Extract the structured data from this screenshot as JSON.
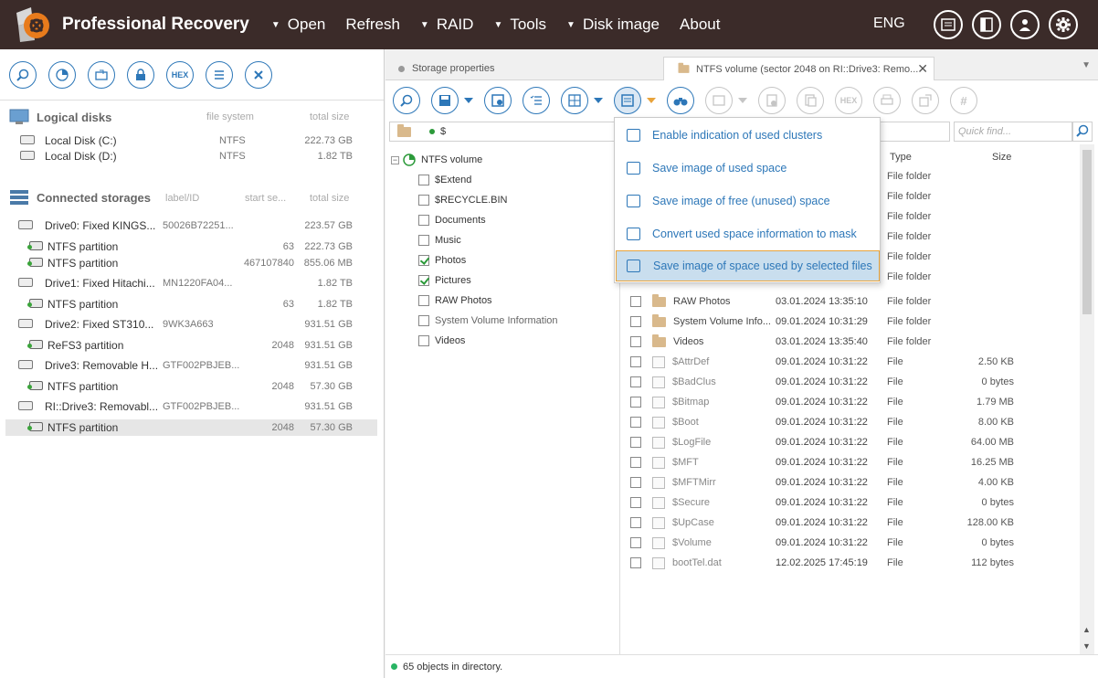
{
  "app": {
    "title": "Professional Recovery",
    "menu": [
      {
        "label": "Open",
        "dropdown": true
      },
      {
        "label": "Refresh",
        "dropdown": false
      },
      {
        "label": "RAID",
        "dropdown": true
      },
      {
        "label": "Tools",
        "dropdown": true
      },
      {
        "label": "Disk image",
        "dropdown": true
      },
      {
        "label": "About",
        "dropdown": false
      }
    ],
    "language": "ENG"
  },
  "left": {
    "logical": {
      "title": "Logical disks",
      "col_fs": "file system",
      "col_size": "total size",
      "items": [
        {
          "name": "Local Disk (C:)",
          "fs": "NTFS",
          "size": "222.73 GB"
        },
        {
          "name": "Local Disk (D:)",
          "fs": "NTFS",
          "size": "1.82 TB"
        }
      ]
    },
    "connected": {
      "title": "Connected storages",
      "col_label": "label/ID",
      "col_start": "start se...",
      "col_size": "total size",
      "items": [
        {
          "kind": "drive",
          "name": "Drive0: Fixed KINGS...",
          "label": "50026B72251...",
          "start": "",
          "size": "223.57 GB"
        },
        {
          "kind": "part",
          "name": "NTFS partition",
          "label": "",
          "start": "63",
          "size": "222.73 GB"
        },
        {
          "kind": "part",
          "name": "NTFS partition",
          "label": "",
          "start": "467107840",
          "size": "855.06 MB"
        },
        {
          "kind": "drive",
          "name": "Drive1: Fixed Hitachi...",
          "label": "MN1220FA04...",
          "start": "",
          "size": "1.82 TB"
        },
        {
          "kind": "part",
          "name": "NTFS partition",
          "label": "",
          "start": "63",
          "size": "1.82 TB"
        },
        {
          "kind": "drive",
          "name": "Drive2: Fixed ST310...",
          "label": "9WK3A663",
          "start": "",
          "size": "931.51 GB"
        },
        {
          "kind": "part",
          "name": "ReFS3 partition",
          "label": "",
          "start": "2048",
          "size": "931.51 GB"
        },
        {
          "kind": "drive",
          "name": "Drive3: Removable H...",
          "label": "GTF002PBJEB...",
          "start": "",
          "size": "931.51 GB"
        },
        {
          "kind": "part",
          "name": "NTFS partition",
          "label": "",
          "start": "2048",
          "size": "57.30 GB"
        },
        {
          "kind": "drive",
          "name": "RI::Drive3: Removabl...",
          "label": "GTF002PBJEB...",
          "start": "",
          "size": "931.51 GB"
        },
        {
          "kind": "part",
          "name": "NTFS partition",
          "label": "",
          "start": "2048",
          "size": "57.30 GB",
          "selected": true
        }
      ]
    }
  },
  "right": {
    "tabs": [
      {
        "label": "Storage properties"
      },
      {
        "label": "NTFS volume (sector 2048 on RI::Drive3: Remo..."
      }
    ],
    "path": "$",
    "find_placeholder": "Quick find...",
    "tree_root": "NTFS volume",
    "tree": [
      {
        "name": "$Extend",
        "checked": false
      },
      {
        "name": "$RECYCLE.BIN",
        "checked": false
      },
      {
        "name": "Documents",
        "checked": false
      },
      {
        "name": "Music",
        "checked": false
      },
      {
        "name": "Photos",
        "checked": true
      },
      {
        "name": "Pictures",
        "checked": true
      },
      {
        "name": "RAW Photos",
        "checked": false
      },
      {
        "name": "System Volume Information",
        "checked": false
      },
      {
        "name": "Videos",
        "checked": false
      }
    ],
    "columns": {
      "type": "Type",
      "size": "Size"
    },
    "hidden_types": [
      "File folder",
      "File folder",
      "File folder",
      "File folder",
      "File folder",
      "File folder"
    ],
    "files": [
      {
        "name": "RAW Photos",
        "date": "03.01.2024 13:35:10",
        "type": "File folder",
        "size": "",
        "folder": true
      },
      {
        "name": "System Volume Info...",
        "date": "09.01.2024 10:31:29",
        "type": "File folder",
        "size": "",
        "folder": true
      },
      {
        "name": "Videos",
        "date": "03.01.2024 13:35:40",
        "type": "File folder",
        "size": "",
        "folder": true
      },
      {
        "name": "$AttrDef",
        "date": "09.01.2024 10:31:22",
        "type": "File",
        "size": "2.50 KB",
        "folder": false
      },
      {
        "name": "$BadClus",
        "date": "09.01.2024 10:31:22",
        "type": "File",
        "size": "0 bytes",
        "folder": false
      },
      {
        "name": "$Bitmap",
        "date": "09.01.2024 10:31:22",
        "type": "File",
        "size": "1.79 MB",
        "folder": false
      },
      {
        "name": "$Boot",
        "date": "09.01.2024 10:31:22",
        "type": "File",
        "size": "8.00 KB",
        "folder": false
      },
      {
        "name": "$LogFile",
        "date": "09.01.2024 10:31:22",
        "type": "File",
        "size": "64.00 MB",
        "folder": false
      },
      {
        "name": "$MFT",
        "date": "09.01.2024 10:31:22",
        "type": "File",
        "size": "16.25 MB",
        "folder": false
      },
      {
        "name": "$MFTMirr",
        "date": "09.01.2024 10:31:22",
        "type": "File",
        "size": "4.00 KB",
        "folder": false
      },
      {
        "name": "$Secure",
        "date": "09.01.2024 10:31:22",
        "type": "File",
        "size": "0 bytes",
        "folder": false
      },
      {
        "name": "$UpCase",
        "date": "09.01.2024 10:31:22",
        "type": "File",
        "size": "128.00 KB",
        "folder": false
      },
      {
        "name": "$Volume",
        "date": "09.01.2024 10:31:22",
        "type": "File",
        "size": "0 bytes",
        "folder": false
      },
      {
        "name": "bootTel.dat",
        "date": "12.02.2025 17:45:19",
        "type": "File",
        "size": "112 bytes",
        "folder": false
      }
    ],
    "status": "65 objects in directory."
  },
  "dropdown": {
    "items": [
      {
        "label": "Enable indication of used clusters",
        "highlighted": false
      },
      {
        "label": "Save image of used space",
        "highlighted": false
      },
      {
        "label": "Save image of free (unused) space",
        "highlighted": false
      },
      {
        "label": "Convert used space information to mask",
        "highlighted": false
      },
      {
        "label": "Save image of space used by selected files",
        "highlighted": true
      }
    ]
  },
  "icons": {
    "left_toolbar": [
      "search-icon",
      "scan-icon",
      "open-image-icon",
      "lock-icon",
      "hex-icon",
      "list-icon",
      "close-icon"
    ],
    "right_toolbar": [
      "search-icon",
      "save-icon",
      "settings-disk-icon",
      "checklist-icon",
      "grid-icon",
      "cluster-map-icon",
      "binoculars-icon",
      "preview-icon",
      "disk-settings-icon",
      "copy-icon",
      "hex-icon",
      "print-icon",
      "export-icon",
      "hash-icon"
    ],
    "header": [
      "terminal-icon",
      "panel-icon",
      "user-icon",
      "gear-icon"
    ],
    "hex_label": "HEX",
    "hash_label": "#"
  },
  "colors": {
    "titlebar": "#3b2b29",
    "accent": "#2d77b8",
    "highlight": "#c9deee",
    "highlight_border": "#e8a33b"
  }
}
